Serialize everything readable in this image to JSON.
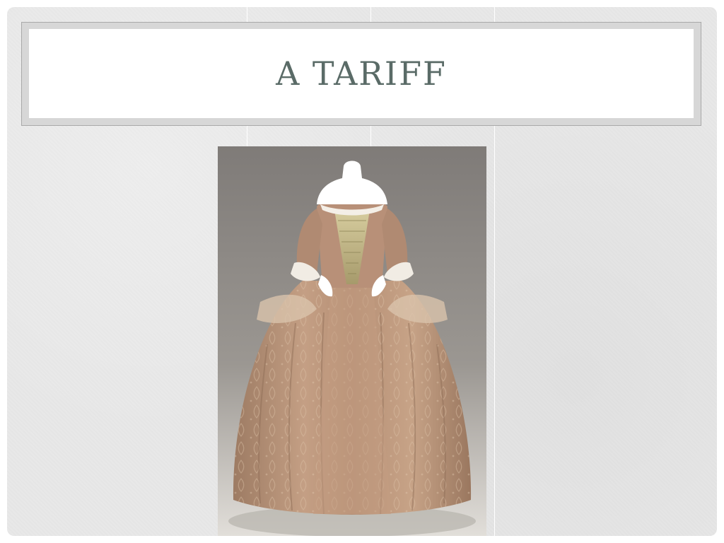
{
  "slide": {
    "title": "A TARIFF",
    "title_color": "#5a6b67",
    "background_color": "#e8e8e8",
    "image": {
      "subject": "dress-on-mannequin",
      "colors": {
        "backdrop": "#8d8985",
        "gown": "#b58e74",
        "stomacher": "#c6b98c",
        "mannequin": "#ffffff"
      }
    }
  }
}
